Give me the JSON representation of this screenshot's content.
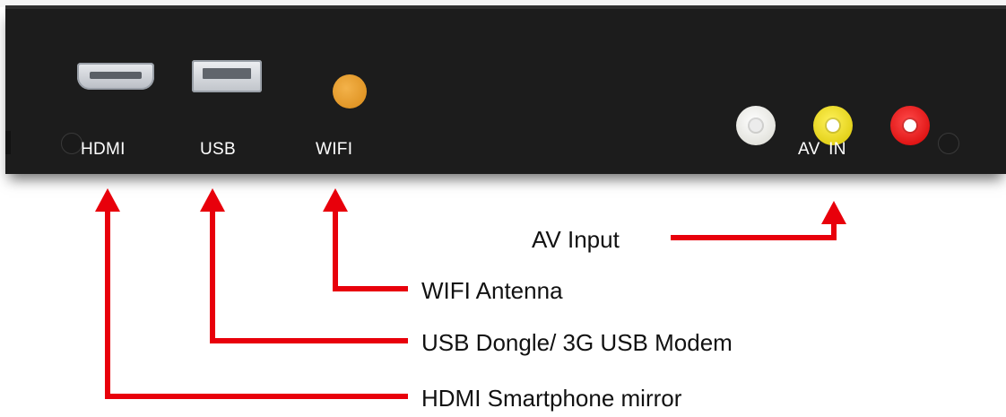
{
  "device": {
    "port_labels": {
      "hdmi": "HDMI",
      "usb": "USB",
      "wifi": "WIFI",
      "av_in": "AV IN"
    }
  },
  "callouts": {
    "av_input": "AV Input",
    "wifi_antenna": "WIFI Antenna",
    "usb_dongle": "USB Dongle/ 3G USB Modem",
    "hdmi_mirror": "HDMI Smartphone mirror"
  },
  "colors": {
    "panel": "#1c1c1c",
    "arrow": "#e8000b",
    "wifi_connector": "#f0a030",
    "rca_white": "#f4f4ee",
    "rca_yellow": "#f5e600",
    "rca_red": "#ee1111"
  }
}
